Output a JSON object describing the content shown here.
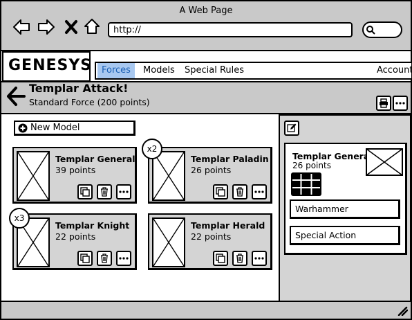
{
  "window": {
    "title": "A Web Page",
    "url": "http://"
  },
  "app": {
    "logo": "GENESYS",
    "menu": {
      "items": [
        "Forces",
        "Models",
        "Special Rules"
      ],
      "active": "Forces",
      "account": "Account"
    }
  },
  "force": {
    "title": "Templar Attack!",
    "subtitle": "Standard Force (200 points)"
  },
  "main": {
    "new_model_label": "New Model",
    "models": [
      {
        "name": "Templar General",
        "points": "39 points",
        "badge": ""
      },
      {
        "name": "Templar Paladin",
        "points": "26 points",
        "badge": "x2"
      },
      {
        "name": "Templar Knight",
        "points": "22 points",
        "badge": "x3"
      },
      {
        "name": "Templar Herald",
        "points": "22 points",
        "badge": ""
      }
    ]
  },
  "detail": {
    "name": "Templar General",
    "points": "26 points",
    "weapon": "Warhammer",
    "action": "Special Action"
  },
  "icons": [
    "back-icon",
    "forward-icon",
    "stop-icon",
    "home-icon",
    "search-icon",
    "arrow-left-icon",
    "print-icon",
    "more-icon",
    "plus-circle-icon",
    "copy-icon",
    "trash-icon",
    "edit-icon",
    "grid-icon",
    "resize-grip-icon"
  ]
}
